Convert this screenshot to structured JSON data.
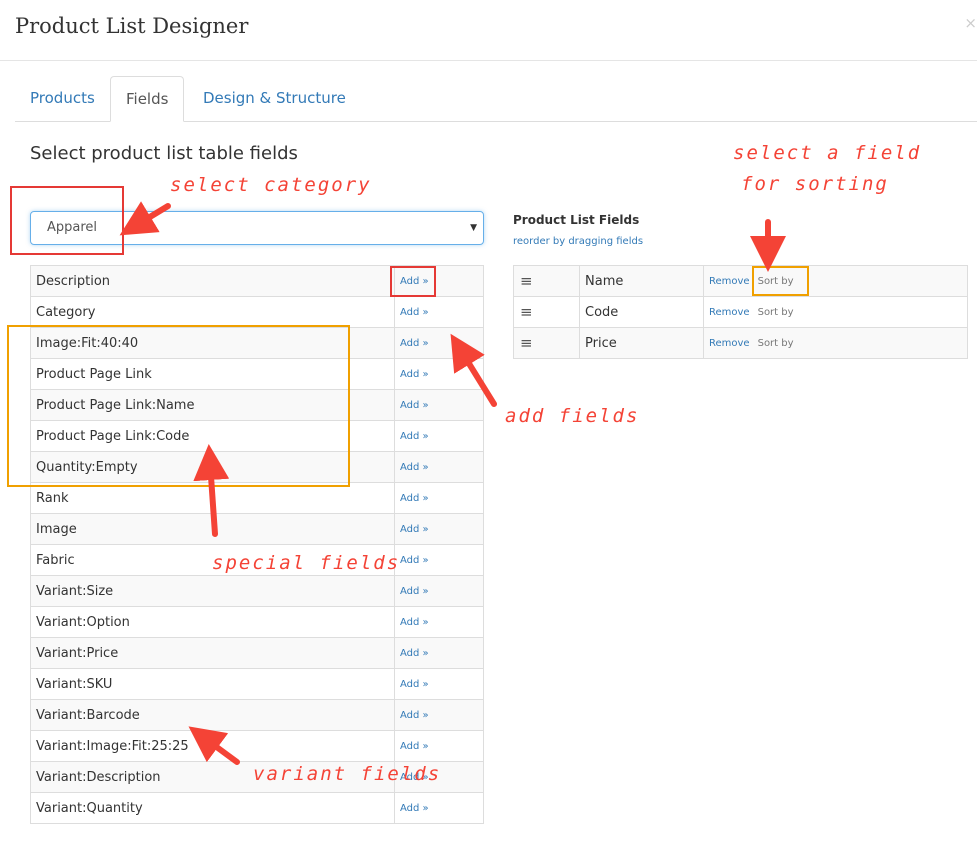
{
  "dialog": {
    "title": "Product List Designer",
    "close": "×"
  },
  "tabs": [
    {
      "label": "Products"
    },
    {
      "label": "Fields"
    },
    {
      "label": "Design & Structure"
    }
  ],
  "section_title": "Select product list table fields",
  "category_select": {
    "value": "Apparel"
  },
  "available_fields": {
    "add_label": "Add »",
    "items": [
      "Description",
      "Category",
      "Image:Fit:40:40",
      "Product Page Link",
      "Product Page Link:Name",
      "Product Page Link:Code",
      "Quantity:Empty",
      "Rank",
      "Image",
      "Fabric",
      "Variant:Size",
      "Variant:Option",
      "Variant:Price",
      "Variant:SKU",
      "Variant:Barcode",
      "Variant:Image:Fit:25:25",
      "Variant:Description",
      "Variant:Quantity"
    ]
  },
  "selected_fields": {
    "title": "Product List Fields",
    "subtitle": "reorder by dragging fields",
    "remove_label": "Remove",
    "sort_label": "Sort by",
    "items": [
      "Name",
      "Code",
      "Price"
    ]
  },
  "annotations": {
    "select_category": "select category",
    "select_sort_1": "select a field",
    "select_sort_2": "for sorting",
    "add_fields": "add fields",
    "special_fields": "special fields",
    "variant_fields": "variant fields"
  },
  "colors": {
    "accent": "#337ab7",
    "annotation_red": "#f44336",
    "annotation_orange": "#f0a000"
  }
}
